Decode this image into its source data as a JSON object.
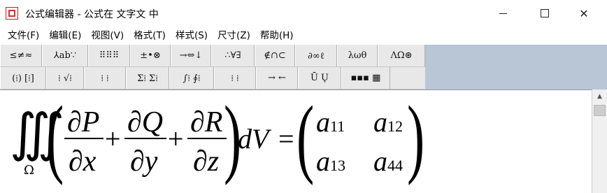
{
  "window": {
    "title": "公式编辑器 - 公式在 文字文 中",
    "icon": "equation-editor-app-icon"
  },
  "menu": [
    {
      "label": "文件(F)"
    },
    {
      "label": "编辑(E)"
    },
    {
      "label": "视图(V)"
    },
    {
      "label": "格式(T)"
    },
    {
      "label": "样式(S)"
    },
    {
      "label": "尺寸(Z)"
    },
    {
      "label": "帮助(H)"
    }
  ],
  "toolbar_row1": [
    "≤≠≈",
    "⅄ab∵",
    "⠿⠿⠿",
    "±•⊗",
    "→⇔↓",
    "∴∀∃",
    "∉∩⊂",
    "∂∞ℓ",
    "λωθ",
    "ΛΩ⊛"
  ],
  "toolbar_row2": [
    "(⁞) [⁞]",
    "⁞ √⁞",
    "⁞ ⁞",
    "Σ⁞ Σ⁞",
    "∫⁞ ∮⁞",
    "⁞ ⁞",
    "→ ←",
    "Ū Ų",
    "▪▪▪ ▦"
  ],
  "equation": {
    "integral": "∭",
    "domain": "Ω",
    "terms": [
      {
        "num": "∂P",
        "den": "∂x"
      },
      {
        "num": "∂Q",
        "den": "∂y"
      },
      {
        "num": "∂R",
        "den": "∂z"
      }
    ],
    "plus": "+",
    "differential": "dV",
    "equals": "=",
    "matrix": [
      [
        "a",
        "11",
        "a",
        "12"
      ],
      [
        "a",
        "13",
        "a",
        "44"
      ]
    ]
  },
  "colors": {
    "toolbar_bg": "#e8e8e8",
    "toolbar_area_bg": "#b8c6d6"
  }
}
